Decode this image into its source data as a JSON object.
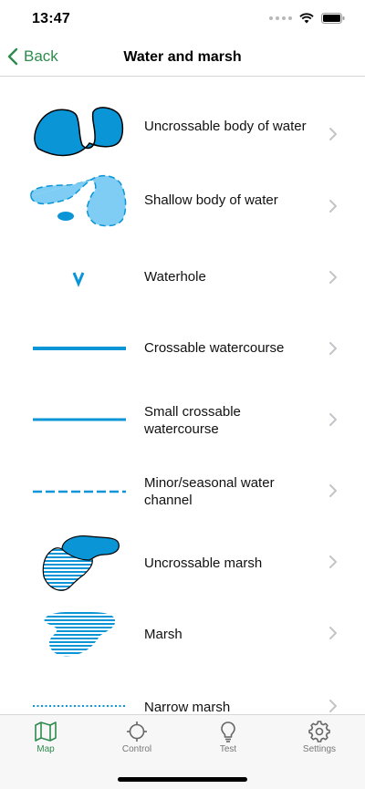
{
  "status": {
    "time": "13:47",
    "icons": [
      "cellular-dots-icon",
      "wifi-icon",
      "battery-icon"
    ]
  },
  "nav": {
    "back_label": "Back",
    "title": "Water and marsh"
  },
  "items": [
    {
      "label": "Uncrossable body of water",
      "symbol": "uncrossable-water-icon"
    },
    {
      "label": "Shallow body of water",
      "symbol": "shallow-water-icon"
    },
    {
      "label": "Waterhole",
      "symbol": "waterhole-icon"
    },
    {
      "label": "Crossable watercourse",
      "symbol": "crossable-watercourse-icon"
    },
    {
      "label": "Small crossable watercourse",
      "symbol": "small-watercourse-icon"
    },
    {
      "label": "Minor/seasonal water channel",
      "symbol": "seasonal-channel-icon"
    },
    {
      "label": "Uncrossable marsh",
      "symbol": "uncrossable-marsh-icon"
    },
    {
      "label": "Marsh",
      "symbol": "marsh-icon"
    },
    {
      "label": "Narrow marsh",
      "symbol": "narrow-marsh-icon"
    }
  ],
  "tabs": [
    {
      "label": "Map",
      "icon": "map-icon",
      "active": true
    },
    {
      "label": "Control",
      "icon": "crosshair-icon",
      "active": false
    },
    {
      "label": "Test",
      "icon": "lightbulb-icon",
      "active": false
    },
    {
      "label": "Settings",
      "icon": "gear-icon",
      "active": false
    }
  ],
  "colors": {
    "accent": "#2e8b4e",
    "water": "#0a95d6",
    "shallow_water": "#7fcdf5",
    "divider": "#d6d6d6"
  },
  "status_waterhole_glyph": "v"
}
